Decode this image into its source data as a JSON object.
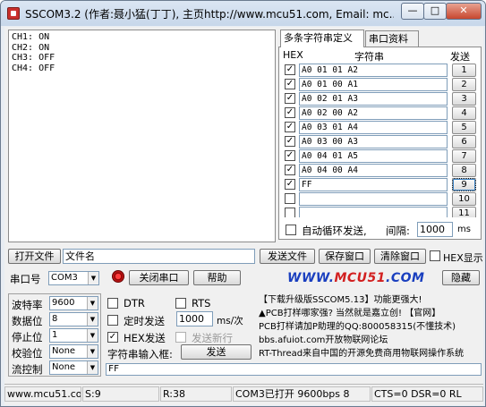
{
  "window": {
    "title": "SSCOM3.2 (作者:聂小猛(丁丁), 主页http://www.mcu51.com,  Email: mc...",
    "min_label": "—",
    "max_label": "□",
    "close_label": "✕"
  },
  "receive": {
    "lines": [
      "CH1: ON",
      "CH2: ON",
      "CH3: OFF",
      "CH4: OFF"
    ]
  },
  "tabs": [
    "多条字符串定义",
    "串口资料"
  ],
  "multi": {
    "col_hex": "HEX",
    "col_string": "字符串",
    "col_send": "发送",
    "rows": [
      {
        "checked": true,
        "value": "A0 01 01 A2",
        "btn": "1"
      },
      {
        "checked": true,
        "value": "A0 01 00 A1",
        "btn": "2"
      },
      {
        "checked": true,
        "value": "A0 02 01 A3",
        "btn": "3"
      },
      {
        "checked": true,
        "value": "A0 02 00 A2",
        "btn": "4"
      },
      {
        "checked": true,
        "value": "A0 03 01 A4",
        "btn": "5"
      },
      {
        "checked": true,
        "value": "A0 03 00 A3",
        "btn": "6"
      },
      {
        "checked": true,
        "value": "A0 04 01 A5",
        "btn": "7"
      },
      {
        "checked": true,
        "value": "A0 04 00 A4",
        "btn": "8"
      },
      {
        "checked": true,
        "value": "FF",
        "btn": "9"
      },
      {
        "checked": false,
        "value": "",
        "btn": "10"
      },
      {
        "checked": false,
        "value": "",
        "btn": "11"
      }
    ],
    "loop_label": "自动循环发送,",
    "interval_label": "间隔:",
    "interval_value": "1000",
    "interval_unit": "ms"
  },
  "toolbar1": {
    "open_file": "打开文件",
    "file_name": "文件名",
    "send_file": "发送文件",
    "save_window": "保存窗口",
    "clear_window": "清除窗口",
    "hex_display": "HEX显示"
  },
  "toolbar2": {
    "port_label": "串口号",
    "port_value": "COM3",
    "close_port": "关闭串口",
    "help": "帮助",
    "logo_a": "WWW.",
    "logo_b": "MCU51",
    "logo_c": ".COM",
    "hide": "隐藏"
  },
  "settings": {
    "baud_label": "波特率",
    "baud_value": "9600",
    "data_label": "数据位",
    "data_value": "8",
    "stop_label": "停止位",
    "stop_value": "1",
    "parity_label": "校验位",
    "parity_value": "None",
    "flow_label": "流控制",
    "flow_value": "None"
  },
  "options": {
    "dtr": "DTR",
    "rts": "RTS",
    "timed_send": "定时发送",
    "timed_value": "1000",
    "timed_unit": "ms/次",
    "hex_send": "HEX发送",
    "send_newline": "发送新行",
    "input_label": "字符串输入框:",
    "send_button": "发送",
    "input_value": "FF"
  },
  "ad": {
    "lines": [
      "【下载升级版SSCOM5.13】功能更强大!",
      "▲PCB打样哪家强? 当然就是嘉立创! 【官网】",
      "PCB打样请加P助理的QQ:800058315(不懂技术)",
      "bbs.afuiot.com开放物联网论坛",
      "RT-Thread来自中国的开源免费商用物联网操作系统"
    ]
  },
  "status": {
    "site": "www.mcu51.cor",
    "sent": "S:9",
    "received": "R:38",
    "port_state": "COM3已打开  9600bps  8",
    "lines": "CTS=0 DSR=0 RL"
  },
  "colors": {
    "logo_blue": "#1a3fbf",
    "logo_red": "#d21f1f",
    "titlebar": "#c7d7ea"
  }
}
